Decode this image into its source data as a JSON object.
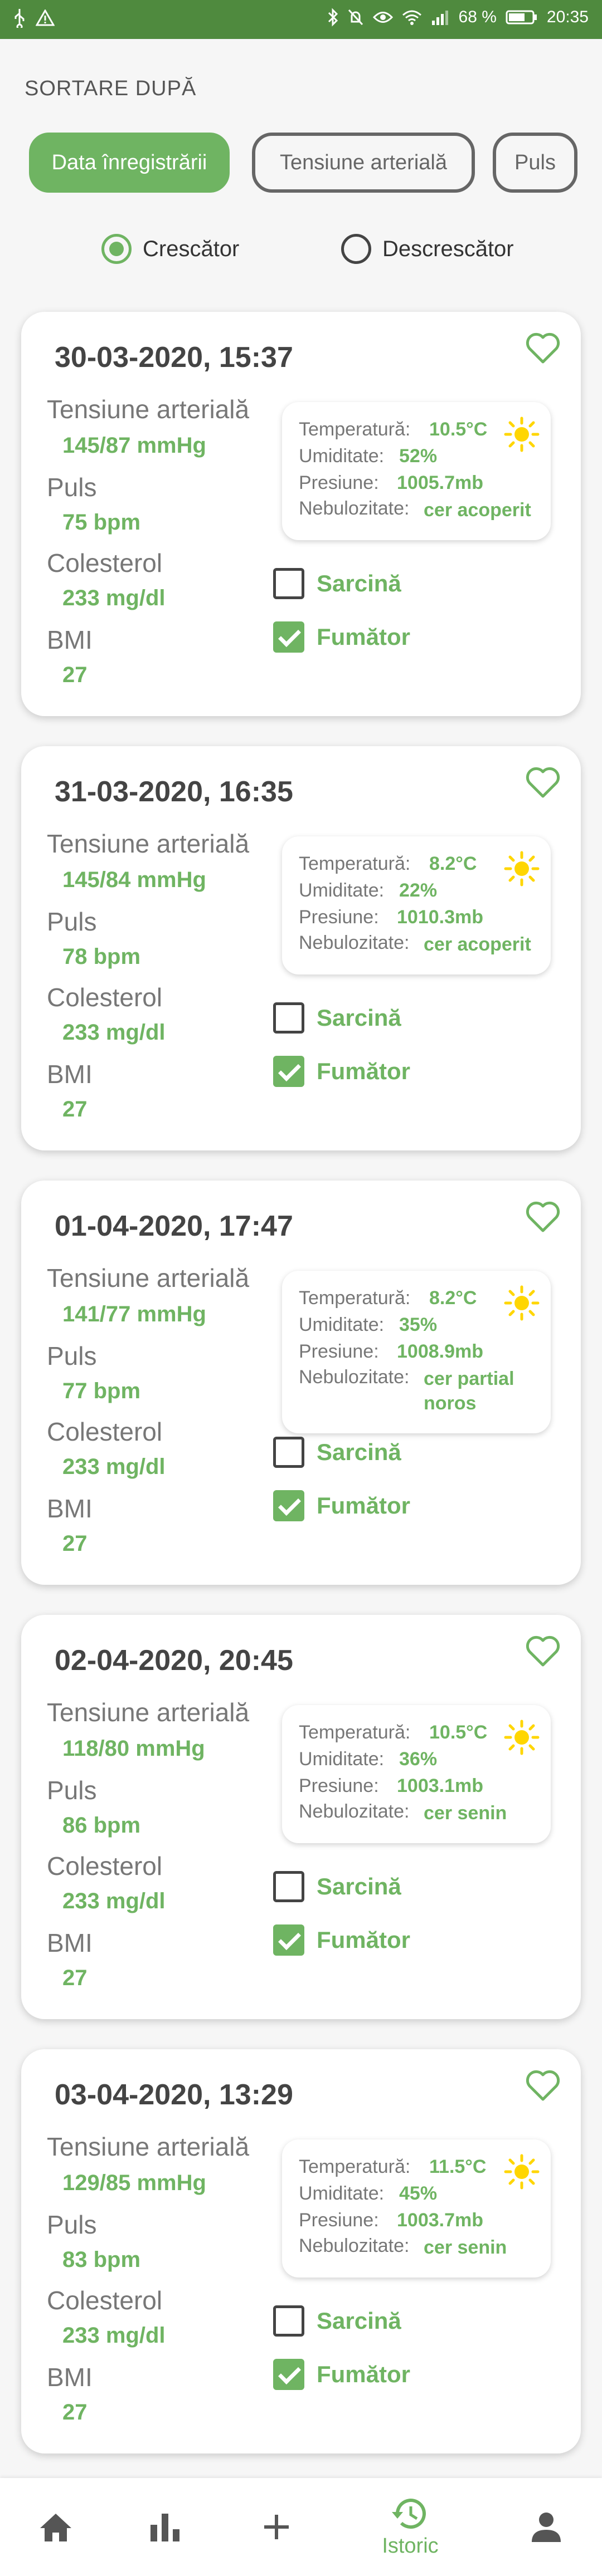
{
  "status_bar": {
    "battery_percent": "68 %",
    "time": "20:35",
    "left_icons": [
      "usb-icon",
      "warning-icon"
    ],
    "right_icons": [
      "bluetooth-icon",
      "mute-icon",
      "eye-icon",
      "wifi-icon",
      "signal-icon",
      "battery-icon"
    ]
  },
  "sort": {
    "title": "SORTARE DUPĂ",
    "chips": [
      {
        "label": "Data înregistrării",
        "active": true
      },
      {
        "label": "Tensiune arterială",
        "active": false
      },
      {
        "label": "Puls",
        "active": false
      }
    ],
    "order": [
      {
        "label": "Crescător",
        "checked": true
      },
      {
        "label": "Descrescător",
        "checked": false
      }
    ]
  },
  "labels": {
    "bp": "Tensiune arterială",
    "pulse": "Puls",
    "cholesterol": "Colesterol",
    "bmi": "BMI",
    "temperature": "Temperatură:",
    "humidity": "Umiditate:",
    "pressure": "Presiune:",
    "cloudiness": "Nebulozitate:",
    "pregnancy": "Sarcină",
    "smoker": "Fumător"
  },
  "records": [
    {
      "date": "30-03-2020, 15:37",
      "bp": "145/87 mmHg",
      "pulse": "75 bpm",
      "cholesterol": "233 mg/dl",
      "bmi": "27",
      "temp": "10.5°C",
      "humidity": "52%",
      "pressure": "1005.7mb",
      "cloud": "cer acoperit",
      "pregnant": false,
      "smoker": true
    },
    {
      "date": "31-03-2020, 16:35",
      "bp": "145/84 mmHg",
      "pulse": "78 bpm",
      "cholesterol": "233 mg/dl",
      "bmi": "27",
      "temp": "8.2°C",
      "humidity": "22%",
      "pressure": "1010.3mb",
      "cloud": "cer acoperit",
      "pregnant": false,
      "smoker": true
    },
    {
      "date": "01-04-2020, 17:47",
      "bp": "141/77 mmHg",
      "pulse": "77 bpm",
      "cholesterol": "233 mg/dl",
      "bmi": "27",
      "temp": "8.2°C",
      "humidity": "35%",
      "pressure": "1008.9mb",
      "cloud_line1": "cer partial",
      "cloud_line2": "noros",
      "pregnant": false,
      "smoker": true
    },
    {
      "date": "02-04-2020, 20:45",
      "bp": "118/80 mmHg",
      "pulse": "86 bpm",
      "cholesterol": "233 mg/dl",
      "bmi": "27",
      "temp": "10.5°C",
      "humidity": "36%",
      "pressure": "1003.1mb",
      "cloud": "cer senin",
      "pregnant": false,
      "smoker": true
    },
    {
      "date": "03-04-2020, 13:29",
      "bp": "129/85 mmHg",
      "pulse": "83 bpm",
      "cholesterol": "233 mg/dl",
      "bmi": "27",
      "temp": "11.5°C",
      "humidity": "45%",
      "pressure": "1003.7mb",
      "cloud": "cer senin",
      "pregnant": false,
      "smoker": true
    }
  ],
  "bottom_nav": {
    "items": [
      {
        "icon": "home-icon",
        "label": ""
      },
      {
        "icon": "bar-chart-icon",
        "label": ""
      },
      {
        "icon": "plus-icon",
        "label": ""
      },
      {
        "icon": "history-icon",
        "label": "Istoric",
        "active": true
      },
      {
        "icon": "person-icon",
        "label": ""
      }
    ]
  },
  "colors": {
    "accent": "#6fb462",
    "status_bar": "#4f8a3e",
    "sun": "#ffd600"
  }
}
